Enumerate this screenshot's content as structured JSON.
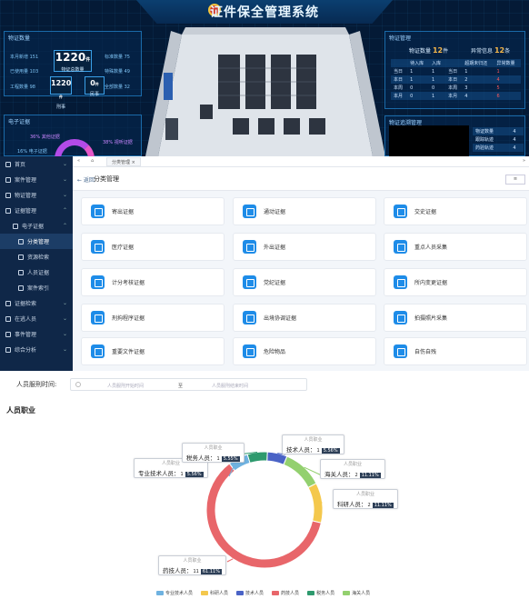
{
  "dashboard": {
    "title": "证件保全管理系统",
    "left_panel_title": "物证数量",
    "left_stats": [
      "本月新增 151",
      "标准数量 75",
      "已使用量 103",
      "特殊数量 49",
      "工程数量 98",
      "全部数量 32"
    ],
    "center_number": "1220",
    "center_unit": "件",
    "center_label": "物证总数量",
    "num2": "1220",
    "num2_unit": "件",
    "num2_label": "刑事",
    "num3": "0",
    "num3_unit": "件",
    "num3_label": "民事",
    "left2_panel_title": "电子证据",
    "donut_labels": [
      "36% 其他证据",
      "38% 视听证据",
      "16% 电子证据"
    ],
    "right_panel_title": "物证管理",
    "right_count_label": "物证数量",
    "right_count": "12",
    "right_count_unit": "件",
    "right_abn_label": "异常信息",
    "right_abn": "12",
    "right_abn_unit": "条",
    "table_headers": [
      "",
      "待入库",
      "入库",
      "",
      "超期未归还",
      "异常数量"
    ],
    "table_rows": [
      [
        "当日",
        "1",
        "1",
        "当日",
        "1",
        "1"
      ],
      [
        "本日",
        "1",
        "1",
        "本日",
        "2",
        "4"
      ],
      [
        "本周",
        "0",
        "0",
        "本周",
        "3",
        "5"
      ],
      [
        "本月",
        "0",
        "1",
        "本月",
        "4",
        "6"
      ]
    ],
    "right2_panel_title": "物证追溯管理",
    "right2_rows": [
      [
        "物证数量",
        "4"
      ],
      [
        "跟踪轨迹",
        "4"
      ],
      [
        "药验轨迹",
        "4"
      ]
    ]
  },
  "sidebar": {
    "items": [
      {
        "label": "首页",
        "arrow": "⌄"
      },
      {
        "label": "案件管理",
        "arrow": "⌄"
      },
      {
        "label": "物证管理",
        "arrow": "⌄"
      },
      {
        "label": "证据管理",
        "arrow": "⌃"
      },
      {
        "label": "电子证据",
        "arrow": "⌃"
      },
      {
        "label": "分类管理",
        "arrow": ""
      },
      {
        "label": "资源检索",
        "arrow": ""
      },
      {
        "label": "人员证据",
        "arrow": ""
      },
      {
        "label": "案件索引",
        "arrow": ""
      },
      {
        "label": "证据检索",
        "arrow": "⌄"
      },
      {
        "label": "在逃人员",
        "arrow": "⌄"
      },
      {
        "label": "事件管理",
        "arrow": "⌄"
      },
      {
        "label": "综合分析",
        "arrow": "⌄"
      }
    ]
  },
  "main": {
    "tab_label": "分类管理 ×",
    "nav_left": "«",
    "nav_home": "⌂",
    "nav_right": "»",
    "back": "← 返回",
    "title": "分类管理",
    "right_button": "≡",
    "cards": [
      "寄出证据",
      "通动证据",
      "交史证据",
      "医疗证据",
      "外出证据",
      "重点人员采集",
      "计分考核证据",
      "党纪证据",
      "所内变更证据",
      "刑拘程序证据",
      "出境协调证据",
      "拍摄照片采集",
      "重要文件证据",
      "危险物品",
      "自伤自残"
    ]
  },
  "filter": {
    "label": "人员服刑时间:",
    "start_placeholder": "人员服刑开始时间",
    "separator": "至",
    "end_placeholder": "人员服刑结束时间"
  },
  "occupation": {
    "title": "人员职业",
    "tooltip_header": "人员职业"
  },
  "chart_data": {
    "type": "pie",
    "title": "人员职业",
    "series": [
      {
        "name": "专业技术人员",
        "value": 1,
        "percent": "5.56%",
        "color": "#6fb2e0"
      },
      {
        "name": "科研人员",
        "value": 2,
        "percent": "11.11%",
        "color": "#f4c84d"
      },
      {
        "name": "技术人员",
        "value": 1,
        "percent": "5.56%",
        "color": "#4a63c6"
      },
      {
        "name": "药技人员",
        "value": 11,
        "percent": "61.11%",
        "color": "#e8666a"
      },
      {
        "name": "税务人员",
        "value": 1,
        "percent": "5.55%",
        "color": "#2e9a6e"
      },
      {
        "name": "海关人员",
        "value": 2,
        "percent": "11.11%",
        "color": "#93d06f"
      }
    ]
  }
}
